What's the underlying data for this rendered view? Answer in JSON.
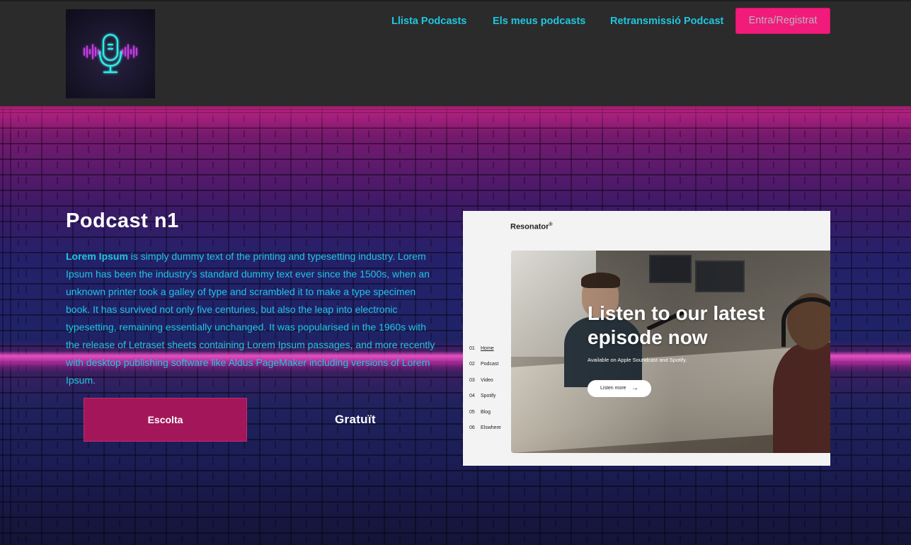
{
  "header": {
    "nav": [
      {
        "label": "Llista Podcasts"
      },
      {
        "label": "Els meus podcasts"
      },
      {
        "label": "Retransmissió Podcast"
      }
    ],
    "login_label": "Entra/Registrat",
    "logo_icon": "microphone-neon-icon"
  },
  "main": {
    "title": "Podcast n1",
    "desc_bold": "Lorem Ipsum",
    "desc_rest": " is simply dummy text of the printing and typesetting industry. Lorem Ipsum has been the industry's standard dummy text ever since the 1500s, when an unknown printer took a galley of type and scrambled it to make a type specimen book. It has survived not only five centuries, but also the leap into electronic typesetting, remaining essentially unchanged. It was popularised in the 1960s with the release of Letraset sheets containing Lorem Ipsum passages, and more recently with desktop publishing software like Aldus PageMaker including versions of Lorem Ipsum.",
    "listen_button": "Escolta",
    "price_label": "Gratuït"
  },
  "preview": {
    "brand": "Resonator",
    "brand_mark": "®",
    "menu": [
      {
        "num": "01",
        "label": "Home"
      },
      {
        "num": "02",
        "label": "Podcast"
      },
      {
        "num": "03",
        "label": "Video"
      },
      {
        "num": "04",
        "label": "Spotify"
      },
      {
        "num": "05",
        "label": "Blog"
      },
      {
        "num": "06",
        "label": "Elswhere"
      }
    ],
    "headline": "Listen to our latest episode now",
    "subline": "Available on Apple Soundcast and Spotify.",
    "cta": "Listen more",
    "cta_icon": "arrow-right-icon"
  },
  "colors": {
    "accent_cyan": "#1fc6e0",
    "accent_pink": "#f01b7a",
    "button_magenta": "#a3175a",
    "header_bg": "#2b2b2b"
  }
}
